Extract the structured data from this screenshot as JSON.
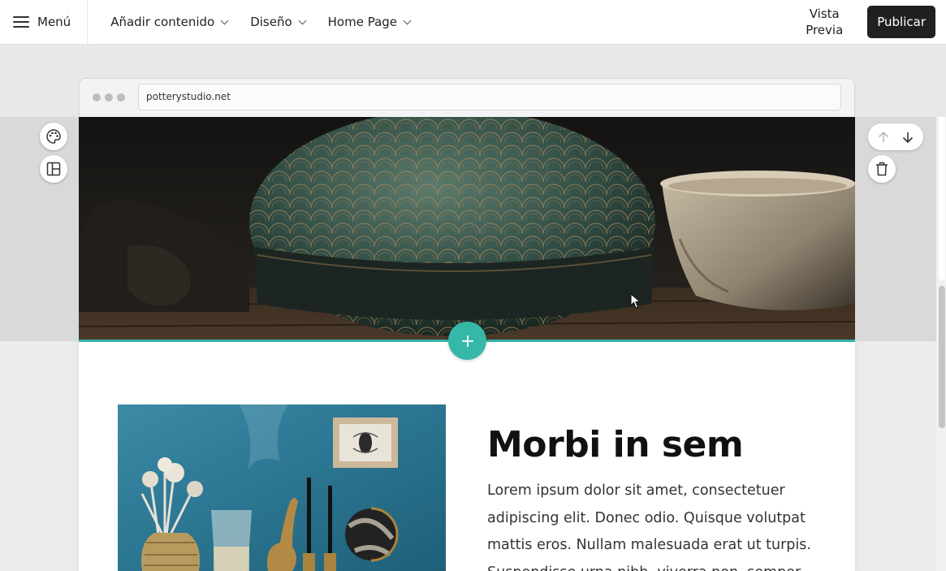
{
  "topbar": {
    "menu_label": "Menú",
    "nav": [
      {
        "label": "Añadir contenido"
      },
      {
        "label": "Diseño"
      },
      {
        "label": "Home Page"
      }
    ],
    "preview_line1": "Vista",
    "preview_line2": "Previa",
    "publish_label": "Publicar"
  },
  "browser": {
    "url": "potterystudio.net"
  },
  "section_tools": {
    "left": [
      "palette-icon",
      "layout-icon"
    ],
    "right": [
      "arrow-up-icon",
      "arrow-down-icon",
      "trash-icon"
    ],
    "add": "plus-icon"
  },
  "content": {
    "headline": "Morbi in sem",
    "paragraph": "Lorem ipsum dolor sit amet, consectetuer adipiscing elit. Donec odio. Quisque volutpat mattis eros. Nullam malesuada erat ut turpis. Suspendisse urna nibh, viverra non, semper"
  },
  "colors": {
    "accent": "#35b8a8",
    "publish_bg": "#202020"
  }
}
